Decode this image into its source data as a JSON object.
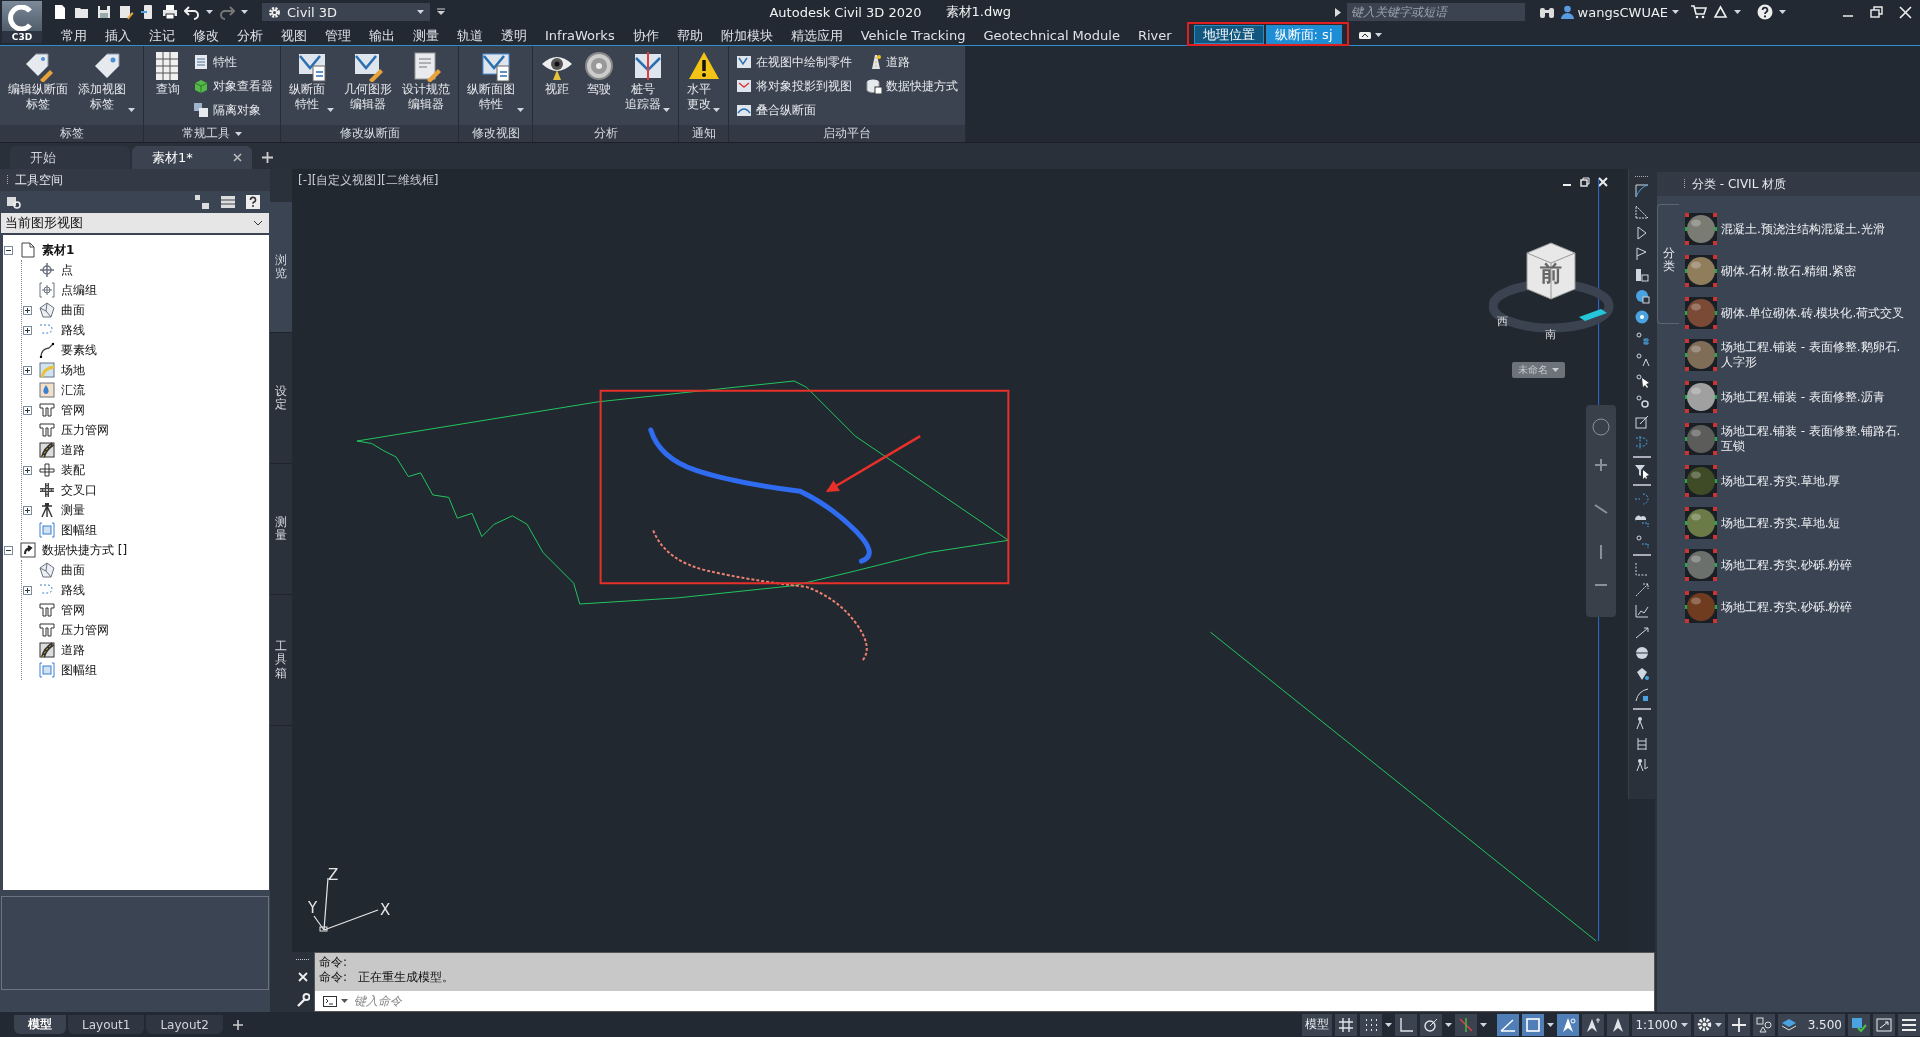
{
  "title_bar": {
    "logo": "C3D",
    "workspace": "Civil 3D",
    "title": "Autodesk Civil 3D 2020",
    "file_name": "素材1.dwg",
    "search_placeholder": "键入关键字或短语",
    "user": "wangsCWUAE"
  },
  "ribbon": {
    "tabs": [
      {
        "label": "常用",
        "selected": false,
        "kind": "normal"
      },
      {
        "label": "插入",
        "selected": false,
        "kind": "normal"
      },
      {
        "label": "注记",
        "selected": false,
        "kind": "normal"
      },
      {
        "label": "修改",
        "selected": false,
        "kind": "normal"
      },
      {
        "label": "分析",
        "selected": false,
        "kind": "normal"
      },
      {
        "label": "视图",
        "selected": false,
        "kind": "normal"
      },
      {
        "label": "管理",
        "selected": false,
        "kind": "normal"
      },
      {
        "label": "输出",
        "selected": false,
        "kind": "normal"
      },
      {
        "label": "测量",
        "selected": false,
        "kind": "normal"
      },
      {
        "label": "轨道",
        "selected": false,
        "kind": "normal"
      },
      {
        "label": "透明",
        "selected": false,
        "kind": "normal"
      },
      {
        "label": "InfraWorks",
        "selected": false,
        "kind": "normal"
      },
      {
        "label": "协作",
        "selected": false,
        "kind": "normal"
      },
      {
        "label": "帮助",
        "selected": false,
        "kind": "normal"
      },
      {
        "label": "附加模块",
        "selected": false,
        "kind": "normal"
      },
      {
        "label": "精选应用",
        "selected": false,
        "kind": "normal"
      },
      {
        "label": "Vehicle Tracking",
        "selected": false,
        "kind": "normal"
      },
      {
        "label": "Geotechnical Module",
        "selected": false,
        "kind": "normal"
      },
      {
        "label": "River",
        "selected": false,
        "kind": "normal"
      },
      {
        "label": "地理位置",
        "selected": false,
        "kind": "contextual"
      },
      {
        "label": "纵断面: sj",
        "selected": true,
        "kind": "contextual"
      }
    ],
    "panels": [
      {
        "title": "标签",
        "has_menu": false,
        "tools": [
          {
            "label_lines": [
              "编辑纵断面",
              "标签"
            ],
            "kind": "large",
            "has_menu": false
          },
          {
            "label_lines": [
              "添加视图",
              "标签"
            ],
            "kind": "large",
            "has_menu": true
          }
        ]
      },
      {
        "title": "常规工具",
        "has_menu": true,
        "tools": [
          {
            "label_lines": [
              "查询"
            ],
            "kind": "large",
            "has_menu": false
          },
          {
            "label": "特性",
            "kind": "small",
            "has_menu": false
          },
          {
            "label": "对象查看器",
            "kind": "small",
            "has_menu": false
          },
          {
            "label": "隔离对象",
            "kind": "small",
            "has_menu": false
          }
        ]
      },
      {
        "title": "修改纵断面",
        "has_menu": false,
        "tools": [
          {
            "label_lines": [
              "纵断面",
              "特性"
            ],
            "kind": "large",
            "has_menu": true
          },
          {
            "label_lines": [
              "几何图形",
              "编辑器"
            ],
            "kind": "large",
            "has_menu": false
          },
          {
            "label_lines": [
              "设计规范",
              "编辑器"
            ],
            "kind": "large",
            "has_menu": false
          }
        ]
      },
      {
        "title": "修改视图",
        "has_menu": false,
        "tools": [
          {
            "label_lines": [
              "纵断面图",
              "特性"
            ],
            "kind": "large",
            "has_menu": true
          }
        ]
      },
      {
        "title": "分析",
        "has_menu": false,
        "tools": [
          {
            "label_lines": [
              "视距"
            ],
            "kind": "large",
            "has_menu": false
          },
          {
            "label_lines": [
              "驾驶"
            ],
            "kind": "large",
            "has_menu": false
          },
          {
            "label_lines": [
              "桩号",
              "追踪器"
            ],
            "kind": "large",
            "has_menu": true
          }
        ]
      },
      {
        "title": "通知",
        "has_menu": false,
        "tools": [
          {
            "label_lines": [
              "水平",
              "更改"
            ],
            "kind": "large",
            "has_menu": true
          }
        ]
      },
      {
        "title": "启动平台",
        "has_menu": false,
        "tools": [
          {
            "label": "在视图中绘制零件",
            "kind": "small",
            "has_menu": false
          },
          {
            "label": "将对象投影到视图",
            "kind": "small",
            "has_menu": false
          },
          {
            "label": "叠合纵断面",
            "kind": "small",
            "has_menu": false
          },
          {
            "label": "道路",
            "kind": "small",
            "has_menu": false
          },
          {
            "label": "数据快捷方式",
            "kind": "small",
            "has_menu": false
          }
        ]
      }
    ]
  },
  "file_tabs": [
    {
      "label": "开始",
      "selected": false,
      "closable": false
    },
    {
      "label": "素材1*",
      "selected": true,
      "closable": true
    }
  ],
  "tool_space": {
    "title": "工具空间",
    "view_selector": "当前图形视图",
    "tree": [
      {
        "label": "素材1",
        "active": true,
        "collapsed": false,
        "children": [
          {
            "label": "点",
            "collapsed": false
          },
          {
            "label": "点编组",
            "collapsed": false
          },
          {
            "label": "曲面",
            "collapsed": true
          },
          {
            "label": "路线",
            "collapsed": true
          },
          {
            "label": "要素线",
            "collapsed": false
          },
          {
            "label": "场地",
            "collapsed": true
          },
          {
            "label": "汇流",
            "collapsed": false
          },
          {
            "label": "管网",
            "collapsed": true
          },
          {
            "label": "压力管网",
            "collapsed": false
          },
          {
            "label": "道路",
            "collapsed": false
          },
          {
            "label": "装配",
            "collapsed": true
          },
          {
            "label": "交叉口",
            "collapsed": false
          },
          {
            "label": "测量",
            "collapsed": true
          },
          {
            "label": "图幅组",
            "collapsed": false
          }
        ]
      },
      {
        "label": "数据快捷方式 []",
        "active": false,
        "collapsed": false,
        "children": [
          {
            "label": "曲面",
            "collapsed": false
          },
          {
            "label": "路线",
            "collapsed": true
          },
          {
            "label": "管网",
            "collapsed": false
          },
          {
            "label": "压力管网",
            "collapsed": false
          },
          {
            "label": "道路",
            "collapsed": false
          },
          {
            "label": "图幅组",
            "collapsed": false
          }
        ]
      }
    ],
    "side_tabs": [
      {
        "label": "浏览",
        "selected": true
      },
      {
        "label": "设定",
        "selected": false
      },
      {
        "label": "测量",
        "selected": false
      },
      {
        "label": "工具箱",
        "selected": false
      }
    ]
  },
  "viewport": {
    "label": "[-][自定义视图][二维线框]",
    "viewcube_face": "前",
    "compass": [
      "西",
      "南"
    ],
    "view_name": "未命名",
    "ucs_axes": [
      "Z",
      "Y",
      "X"
    ]
  },
  "material_palette": {
    "title": "分类 - CIVIL 材质",
    "side_tab": "分类",
    "materials": [
      {
        "name": "混凝土.预浇注结构混凝土.光滑",
        "color": "#7a7b72"
      },
      {
        "name": "砌体.石材.散石.精细.紧密",
        "color": "#8f7d5c"
      },
      {
        "name": "砌体.单位砌体.砖.模块化.荷式交叉",
        "color": "#7b4a36"
      },
      {
        "name": "场地工程.铺装 - 表面修整.鹅卵石.人字形",
        "color": "#7f6d58"
      },
      {
        "name": "场地工程.铺装 - 表面修整.沥青",
        "color": "#a0a0a0"
      },
      {
        "name": "场地工程.铺装 - 表面修整.铺路石.互锁",
        "color": "#5c5c5a"
      },
      {
        "name": "场地工程.夯实.草地.厚",
        "color": "#3f4b26"
      },
      {
        "name": "场地工程.夯实.草地.短",
        "color": "#6b7b47"
      },
      {
        "name": "场地工程.夯实.砂砾.粉碎",
        "color": "#6c706c"
      },
      {
        "name": "场地工程.夯实.砂砾.粉碎",
        "color": "#703c1f"
      }
    ]
  },
  "command_line": {
    "history": [
      "命令:",
      "命令:   正在重生成模型。"
    ],
    "placeholder": "键入命令"
  },
  "layout_tabs": [
    {
      "label": "模型",
      "selected": true
    },
    {
      "label": "Layout1",
      "selected": false
    },
    {
      "label": "Layout2",
      "selected": false
    }
  ],
  "status_bar": {
    "space": "模型",
    "toggles": [
      {
        "on": false
      },
      {
        "on": false
      },
      {
        "on": false
      },
      {
        "on": false
      },
      {
        "on": false
      },
      {
        "on": true
      },
      {
        "on": true
      },
      {
        "on": true
      },
      {
        "on": false
      },
      {
        "on": false
      }
    ],
    "scale": "1:1000",
    "value": "3.500"
  }
}
